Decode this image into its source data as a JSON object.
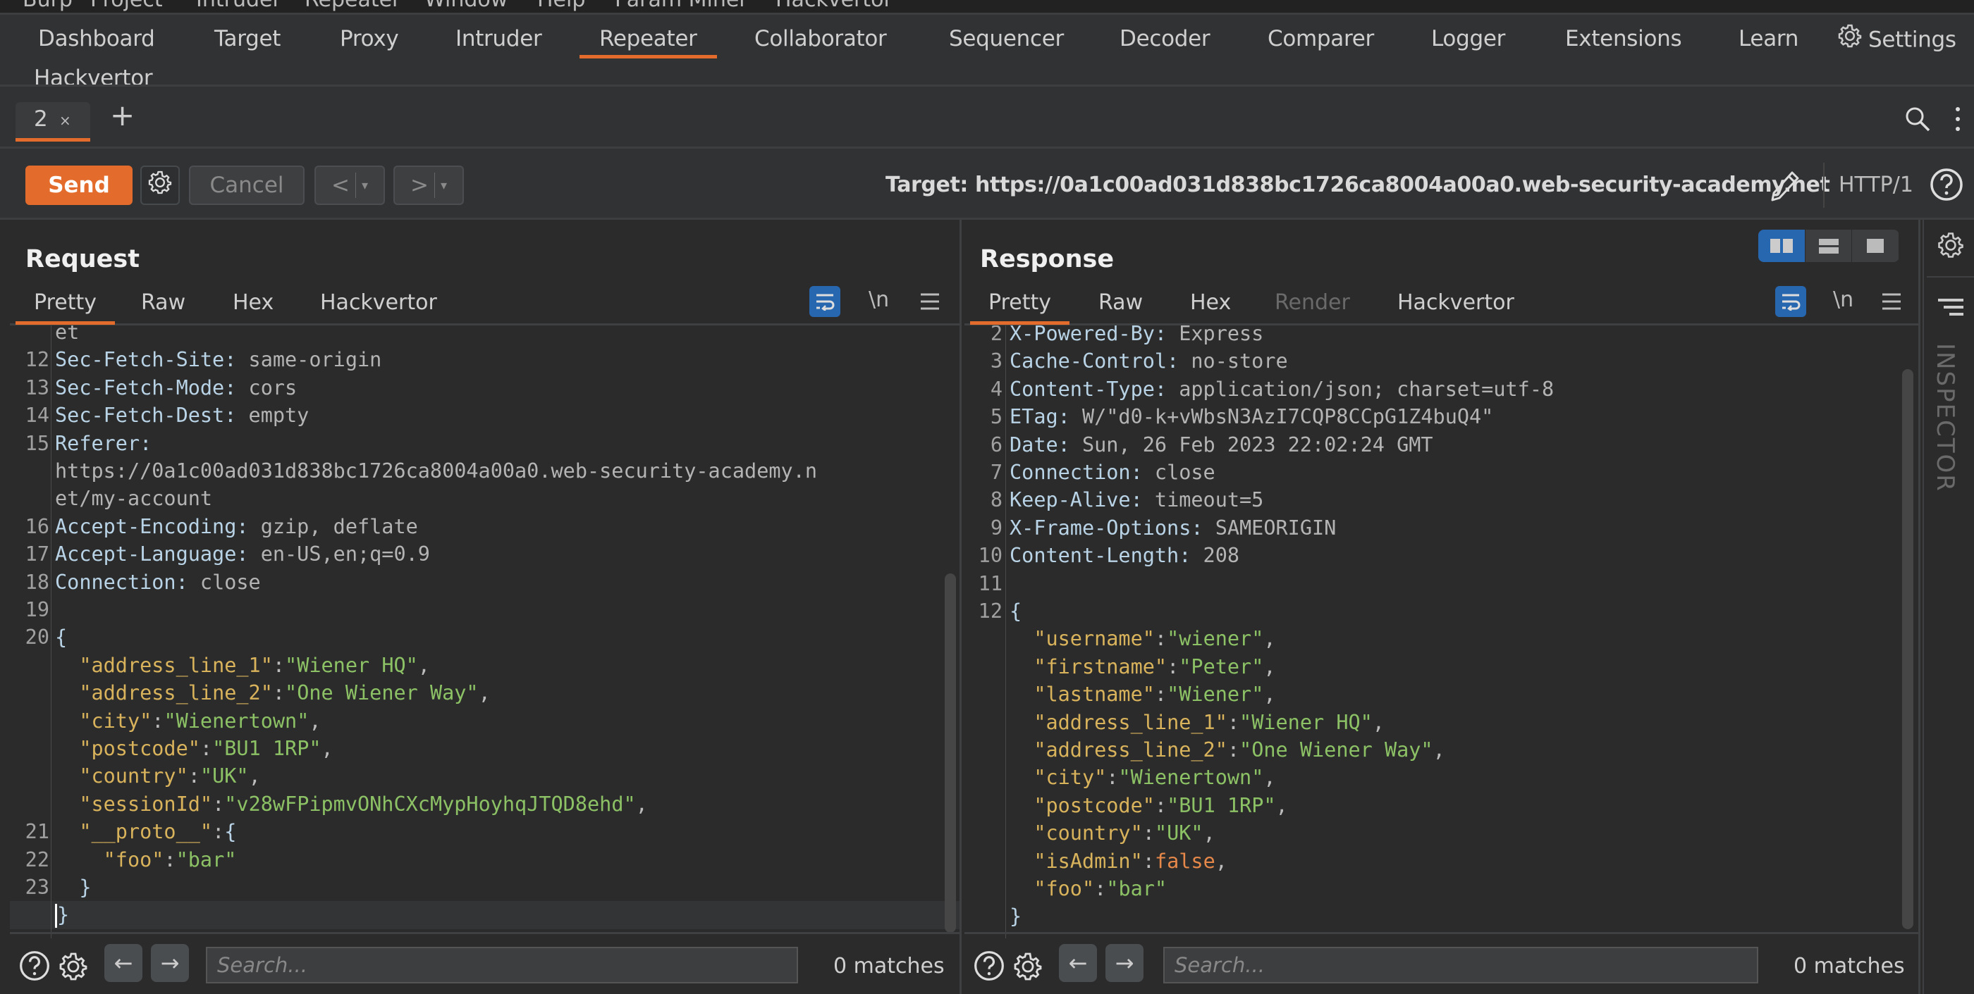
{
  "menubar": [
    "Burp",
    "Project",
    "Intruder",
    "Repeater",
    "Window",
    "Help",
    "Param Miner",
    "Hackvertor"
  ],
  "main_tabs": {
    "row1": [
      "Dashboard",
      "Target",
      "Proxy",
      "Intruder",
      "Repeater",
      "Collaborator",
      "Sequencer",
      "Decoder",
      "Comparer",
      "Logger",
      "Extensions",
      "Learn"
    ],
    "settings": "Settings",
    "row2": [
      "Hackvertor"
    ],
    "active": "Repeater"
  },
  "repeater_tabs": {
    "tabs": [
      {
        "label": "2",
        "close": "×"
      }
    ],
    "add": "+"
  },
  "toolbar": {
    "send": "Send",
    "cancel": "Cancel",
    "back": "<",
    "forward": ">",
    "dropdown": "▾",
    "target": "Target: https://0a1c00ad031d838bc1726ca8004a00a0.web-security-academy.net",
    "http_version": "HTTP/1"
  },
  "request": {
    "title": "Request",
    "tabs": [
      "Pretty",
      "Raw",
      "Hex",
      "Hackvertor"
    ],
    "active_tab": "Pretty",
    "newline_toggle": "\\n",
    "lines": [
      {
        "n": "",
        "parts": [
          {
            "c": "hv",
            "t": "et"
          }
        ]
      },
      {
        "n": "12",
        "parts": [
          {
            "c": "hk",
            "t": "Sec-Fetch-Site:"
          },
          {
            "c": "hv",
            "t": " same-origin"
          }
        ]
      },
      {
        "n": "13",
        "parts": [
          {
            "c": "hk",
            "t": "Sec-Fetch-Mode:"
          },
          {
            "c": "hv",
            "t": " cors"
          }
        ]
      },
      {
        "n": "14",
        "parts": [
          {
            "c": "hk",
            "t": "Sec-Fetch-Dest:"
          },
          {
            "c": "hv",
            "t": " empty"
          }
        ]
      },
      {
        "n": "15",
        "parts": [
          {
            "c": "hk",
            "t": "Referer:"
          }
        ]
      },
      {
        "n": "",
        "parts": [
          {
            "c": "hv",
            "t": "https://0a1c00ad031d838bc1726ca8004a00a0.web-security-academy.n"
          }
        ]
      },
      {
        "n": "",
        "parts": [
          {
            "c": "hv",
            "t": "et/my-account"
          }
        ]
      },
      {
        "n": "16",
        "parts": [
          {
            "c": "hk",
            "t": "Accept-Encoding:"
          },
          {
            "c": "hv",
            "t": " gzip, deflate"
          }
        ]
      },
      {
        "n": "17",
        "parts": [
          {
            "c": "hk",
            "t": "Accept-Language:"
          },
          {
            "c": "hv",
            "t": " en-US,en;q=0.9"
          }
        ]
      },
      {
        "n": "18",
        "parts": [
          {
            "c": "hk",
            "t": "Connection:"
          },
          {
            "c": "hv",
            "t": " close"
          }
        ]
      },
      {
        "n": "19",
        "parts": []
      },
      {
        "n": "20",
        "parts": [
          {
            "c": "jbr",
            "t": "{"
          }
        ]
      },
      {
        "n": "",
        "parts": [
          {
            "c": "jp",
            "t": "  "
          },
          {
            "c": "jk",
            "t": "\"address_line_1\""
          },
          {
            "c": "jp",
            "t": ":"
          },
          {
            "c": "js",
            "t": "\"Wiener HQ\""
          },
          {
            "c": "jp",
            "t": ","
          }
        ]
      },
      {
        "n": "",
        "parts": [
          {
            "c": "jp",
            "t": "  "
          },
          {
            "c": "jk",
            "t": "\"address_line_2\""
          },
          {
            "c": "jp",
            "t": ":"
          },
          {
            "c": "js",
            "t": "\"One Wiener Way\""
          },
          {
            "c": "jp",
            "t": ","
          }
        ]
      },
      {
        "n": "",
        "parts": [
          {
            "c": "jp",
            "t": "  "
          },
          {
            "c": "jk",
            "t": "\"city\""
          },
          {
            "c": "jp",
            "t": ":"
          },
          {
            "c": "js",
            "t": "\"Wienertown\""
          },
          {
            "c": "jp",
            "t": ","
          }
        ]
      },
      {
        "n": "",
        "parts": [
          {
            "c": "jp",
            "t": "  "
          },
          {
            "c": "jk",
            "t": "\"postcode\""
          },
          {
            "c": "jp",
            "t": ":"
          },
          {
            "c": "js",
            "t": "\"BU1 1RP\""
          },
          {
            "c": "jp",
            "t": ","
          }
        ]
      },
      {
        "n": "",
        "parts": [
          {
            "c": "jp",
            "t": "  "
          },
          {
            "c": "jk",
            "t": "\"country\""
          },
          {
            "c": "jp",
            "t": ":"
          },
          {
            "c": "js",
            "t": "\"UK\""
          },
          {
            "c": "jp",
            "t": ","
          }
        ]
      },
      {
        "n": "",
        "parts": [
          {
            "c": "jp",
            "t": "  "
          },
          {
            "c": "jk",
            "t": "\"sessionId\""
          },
          {
            "c": "jp",
            "t": ":"
          },
          {
            "c": "js",
            "t": "\"v28wFPipmvONhCXcMypHoyhqJTQD8ehd\""
          },
          {
            "c": "jp",
            "t": ","
          }
        ]
      },
      {
        "n": "21",
        "parts": [
          {
            "c": "jp",
            "t": "  "
          },
          {
            "c": "jk",
            "t": "\"__proto__\""
          },
          {
            "c": "jp",
            "t": ":"
          },
          {
            "c": "jbr",
            "t": "{"
          }
        ]
      },
      {
        "n": "22",
        "parts": [
          {
            "c": "jp",
            "t": "    "
          },
          {
            "c": "jk",
            "t": "\"foo\""
          },
          {
            "c": "jp",
            "t": ":"
          },
          {
            "c": "js",
            "t": "\"bar\""
          }
        ]
      },
      {
        "n": "23",
        "parts": [
          {
            "c": "jp",
            "t": "  "
          },
          {
            "c": "jbr",
            "t": "}"
          }
        ]
      },
      {
        "n": "",
        "parts": [
          {
            "c": "jbr",
            "t": "}"
          }
        ],
        "current": true
      }
    ],
    "search_placeholder": "Search...",
    "matches": "0 matches"
  },
  "response": {
    "title": "Response",
    "tabs": [
      "Pretty",
      "Raw",
      "Hex",
      "Render",
      "Hackvertor"
    ],
    "disabled_tabs": [
      "Render"
    ],
    "active_tab": "Pretty",
    "newline_toggle": "\\n",
    "lines": [
      {
        "n": "2",
        "parts": [
          {
            "c": "hk",
            "t": "X-Powered-By:"
          },
          {
            "c": "hv",
            "t": " Express"
          }
        ]
      },
      {
        "n": "3",
        "parts": [
          {
            "c": "hk",
            "t": "Cache-Control:"
          },
          {
            "c": "hv",
            "t": " no-store"
          }
        ]
      },
      {
        "n": "4",
        "parts": [
          {
            "c": "hk",
            "t": "Content-Type:"
          },
          {
            "c": "hv",
            "t": " application/json; charset=utf-8"
          }
        ]
      },
      {
        "n": "5",
        "parts": [
          {
            "c": "hk",
            "t": "ETag:"
          },
          {
            "c": "hv",
            "t": " W/\"d0-k+vWbsN3AzI7CQP8CCpG1Z4buQ4\""
          }
        ]
      },
      {
        "n": "6",
        "parts": [
          {
            "c": "hk",
            "t": "Date:"
          },
          {
            "c": "hv",
            "t": " Sun, 26 Feb 2023 22:02:24 GMT"
          }
        ]
      },
      {
        "n": "7",
        "parts": [
          {
            "c": "hk",
            "t": "Connection:"
          },
          {
            "c": "hv",
            "t": " close"
          }
        ]
      },
      {
        "n": "8",
        "parts": [
          {
            "c": "hk",
            "t": "Keep-Alive:"
          },
          {
            "c": "hv",
            "t": " timeout=5"
          }
        ]
      },
      {
        "n": "9",
        "parts": [
          {
            "c": "hk",
            "t": "X-Frame-Options:"
          },
          {
            "c": "hv",
            "t": " SAMEORIGIN"
          }
        ]
      },
      {
        "n": "10",
        "parts": [
          {
            "c": "hk",
            "t": "Content-Length:"
          },
          {
            "c": "hv",
            "t": " 208"
          }
        ]
      },
      {
        "n": "11",
        "parts": []
      },
      {
        "n": "12",
        "parts": [
          {
            "c": "jbr",
            "t": "{"
          }
        ]
      },
      {
        "n": "",
        "parts": [
          {
            "c": "jp",
            "t": "  "
          },
          {
            "c": "jk",
            "t": "\"username\""
          },
          {
            "c": "jp",
            "t": ":"
          },
          {
            "c": "js",
            "t": "\"wiener\""
          },
          {
            "c": "jp",
            "t": ","
          }
        ]
      },
      {
        "n": "",
        "parts": [
          {
            "c": "jp",
            "t": "  "
          },
          {
            "c": "jk",
            "t": "\"firstname\""
          },
          {
            "c": "jp",
            "t": ":"
          },
          {
            "c": "js",
            "t": "\"Peter\""
          },
          {
            "c": "jp",
            "t": ","
          }
        ]
      },
      {
        "n": "",
        "parts": [
          {
            "c": "jp",
            "t": "  "
          },
          {
            "c": "jk",
            "t": "\"lastname\""
          },
          {
            "c": "jp",
            "t": ":"
          },
          {
            "c": "js",
            "t": "\"Wiener\""
          },
          {
            "c": "jp",
            "t": ","
          }
        ]
      },
      {
        "n": "",
        "parts": [
          {
            "c": "jp",
            "t": "  "
          },
          {
            "c": "jk",
            "t": "\"address_line_1\""
          },
          {
            "c": "jp",
            "t": ":"
          },
          {
            "c": "js",
            "t": "\"Wiener HQ\""
          },
          {
            "c": "jp",
            "t": ","
          }
        ]
      },
      {
        "n": "",
        "parts": [
          {
            "c": "jp",
            "t": "  "
          },
          {
            "c": "jk",
            "t": "\"address_line_2\""
          },
          {
            "c": "jp",
            "t": ":"
          },
          {
            "c": "js",
            "t": "\"One Wiener Way\""
          },
          {
            "c": "jp",
            "t": ","
          }
        ]
      },
      {
        "n": "",
        "parts": [
          {
            "c": "jp",
            "t": "  "
          },
          {
            "c": "jk",
            "t": "\"city\""
          },
          {
            "c": "jp",
            "t": ":"
          },
          {
            "c": "js",
            "t": "\"Wienertown\""
          },
          {
            "c": "jp",
            "t": ","
          }
        ]
      },
      {
        "n": "",
        "parts": [
          {
            "c": "jp",
            "t": "  "
          },
          {
            "c": "jk",
            "t": "\"postcode\""
          },
          {
            "c": "jp",
            "t": ":"
          },
          {
            "c": "js",
            "t": "\"BU1 1RP\""
          },
          {
            "c": "jp",
            "t": ","
          }
        ]
      },
      {
        "n": "",
        "parts": [
          {
            "c": "jp",
            "t": "  "
          },
          {
            "c": "jk",
            "t": "\"country\""
          },
          {
            "c": "jp",
            "t": ":"
          },
          {
            "c": "js",
            "t": "\"UK\""
          },
          {
            "c": "jp",
            "t": ","
          }
        ]
      },
      {
        "n": "",
        "parts": [
          {
            "c": "jp",
            "t": "  "
          },
          {
            "c": "jk",
            "t": "\"isAdmin\""
          },
          {
            "c": "jp",
            "t": ":"
          },
          {
            "c": "jb",
            "t": "false"
          },
          {
            "c": "jp",
            "t": ","
          }
        ]
      },
      {
        "n": "",
        "parts": [
          {
            "c": "jp",
            "t": "  "
          },
          {
            "c": "jk",
            "t": "\"foo\""
          },
          {
            "c": "jp",
            "t": ":"
          },
          {
            "c": "js",
            "t": "\"bar\""
          }
        ]
      },
      {
        "n": "",
        "parts": [
          {
            "c": "jbr",
            "t": "}"
          }
        ]
      }
    ],
    "search_placeholder": "Search...",
    "matches": "0 matches"
  },
  "inspector": {
    "label": "INSPECTOR"
  },
  "colors": {
    "accent": "#e36b2b",
    "toggle_blue": "#2767b0",
    "background": "#2b2b2b",
    "json_key": "#d9b35c",
    "json_string": "#8cc265",
    "json_boolean": "#e5884a",
    "header_name": "#b9d3e6",
    "header_value": "#b4b4b4"
  }
}
